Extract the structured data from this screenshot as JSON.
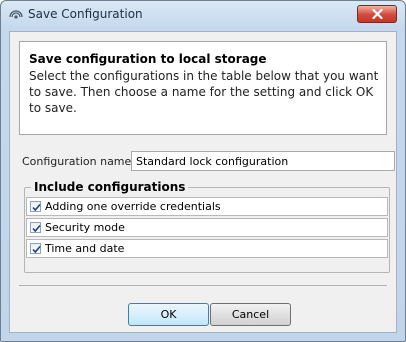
{
  "window": {
    "title": "Save Configuration",
    "icon": "configuration-icon",
    "close_icon": "close-icon"
  },
  "header": {
    "title": "Save configuration to local storage",
    "description": "Select the configurations in the table below that you want to save. Then choose a name for the setting and click OK to save."
  },
  "form": {
    "name_label": "Configuration name",
    "name_value": "Standard lock configuration"
  },
  "include": {
    "title": "Include configurations",
    "items": [
      {
        "label": "Adding one override credentials",
        "checked": true
      },
      {
        "label": "Security mode",
        "checked": true
      },
      {
        "label": "Time and date",
        "checked": true
      }
    ]
  },
  "buttons": {
    "ok": "OK",
    "cancel": "Cancel"
  },
  "colors": {
    "close_button": "#c0392b",
    "ok_button_border": "#3c7fb1"
  }
}
